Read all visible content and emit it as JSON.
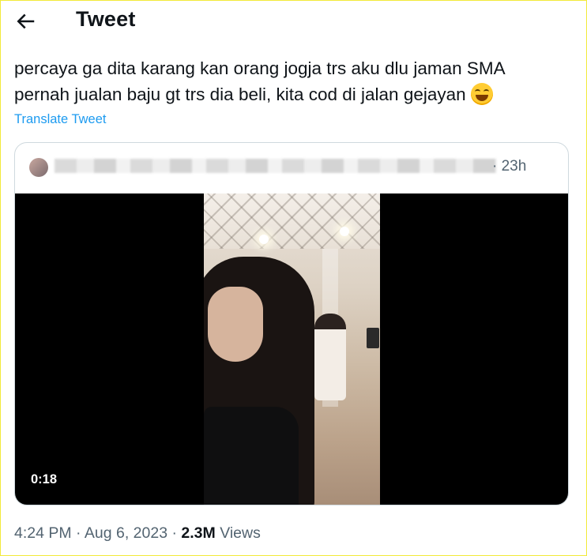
{
  "header": {
    "title": "Tweet"
  },
  "tweet": {
    "text_line1": "percaya ga dita karang kan orang jogja trs aku dlu jaman SMA",
    "text_line2": "pernah jualan baju gt trs dia beli, kita cod di jalan gejayan",
    "emoji": "grinning-face-with-smiling-eyes",
    "translate_label": "Translate Tweet"
  },
  "quote": {
    "time": "· 23h",
    "video_duration": "0:18"
  },
  "meta": {
    "time": "4:24 PM",
    "sep1": " · ",
    "date": "Aug 6, 2023",
    "sep2": " · ",
    "views_count": "2.3M",
    "views_label": " Views"
  },
  "colors": {
    "link": "#1d9bf0",
    "secondary_text": "#536471",
    "primary_text": "#0f1419",
    "border": "#cfd9de"
  }
}
